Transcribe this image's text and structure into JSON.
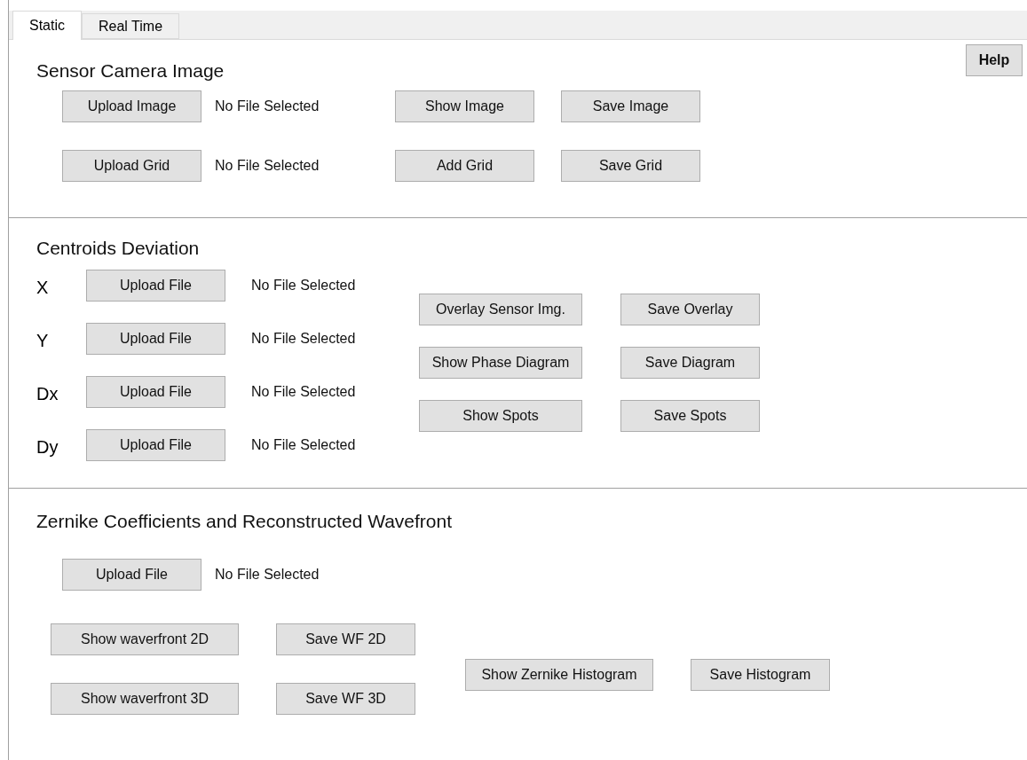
{
  "tabs": [
    {
      "label": "Static",
      "selected": true
    },
    {
      "label": "Real Time",
      "selected": false
    }
  ],
  "help_button": "Help",
  "sensor": {
    "title": "Sensor Camera Image",
    "rows": [
      {
        "upload": "Upload Image",
        "status": "No File Selected",
        "show": "Show Image",
        "save": "Save Image"
      },
      {
        "upload": "Upload Grid",
        "status": "No File Selected",
        "show": "Add Grid",
        "save": "Save Grid"
      }
    ]
  },
  "centroids": {
    "title": "Centroids Deviation",
    "inputs": [
      {
        "label": "X",
        "upload": "Upload File",
        "status": "No File Selected"
      },
      {
        "label": "Y",
        "upload": "Upload File",
        "status": "No File Selected"
      },
      {
        "label": "Dx",
        "upload": "Upload File",
        "status": "No File Selected"
      },
      {
        "label": "Dy",
        "upload": "Upload File",
        "status": "No File Selected"
      }
    ],
    "actions": [
      {
        "show": "Overlay Sensor Img.",
        "save": "Save Overlay"
      },
      {
        "show": "Show Phase Diagram",
        "save": "Save Diagram"
      },
      {
        "show": "Show Spots",
        "save": "Save Spots"
      }
    ]
  },
  "zernike": {
    "title": "Zernike Coefficients and Reconstructed Wavefront",
    "upload": "Upload File",
    "status": "No File Selected",
    "wavefront": [
      {
        "show": "Show waverfront 2D",
        "save": "Save WF 2D"
      },
      {
        "show": "Show waverfront 3D",
        "save": "Save WF 3D"
      }
    ],
    "histogram": {
      "show": "Show Zernike Histogram",
      "save": "Save Histogram"
    }
  }
}
